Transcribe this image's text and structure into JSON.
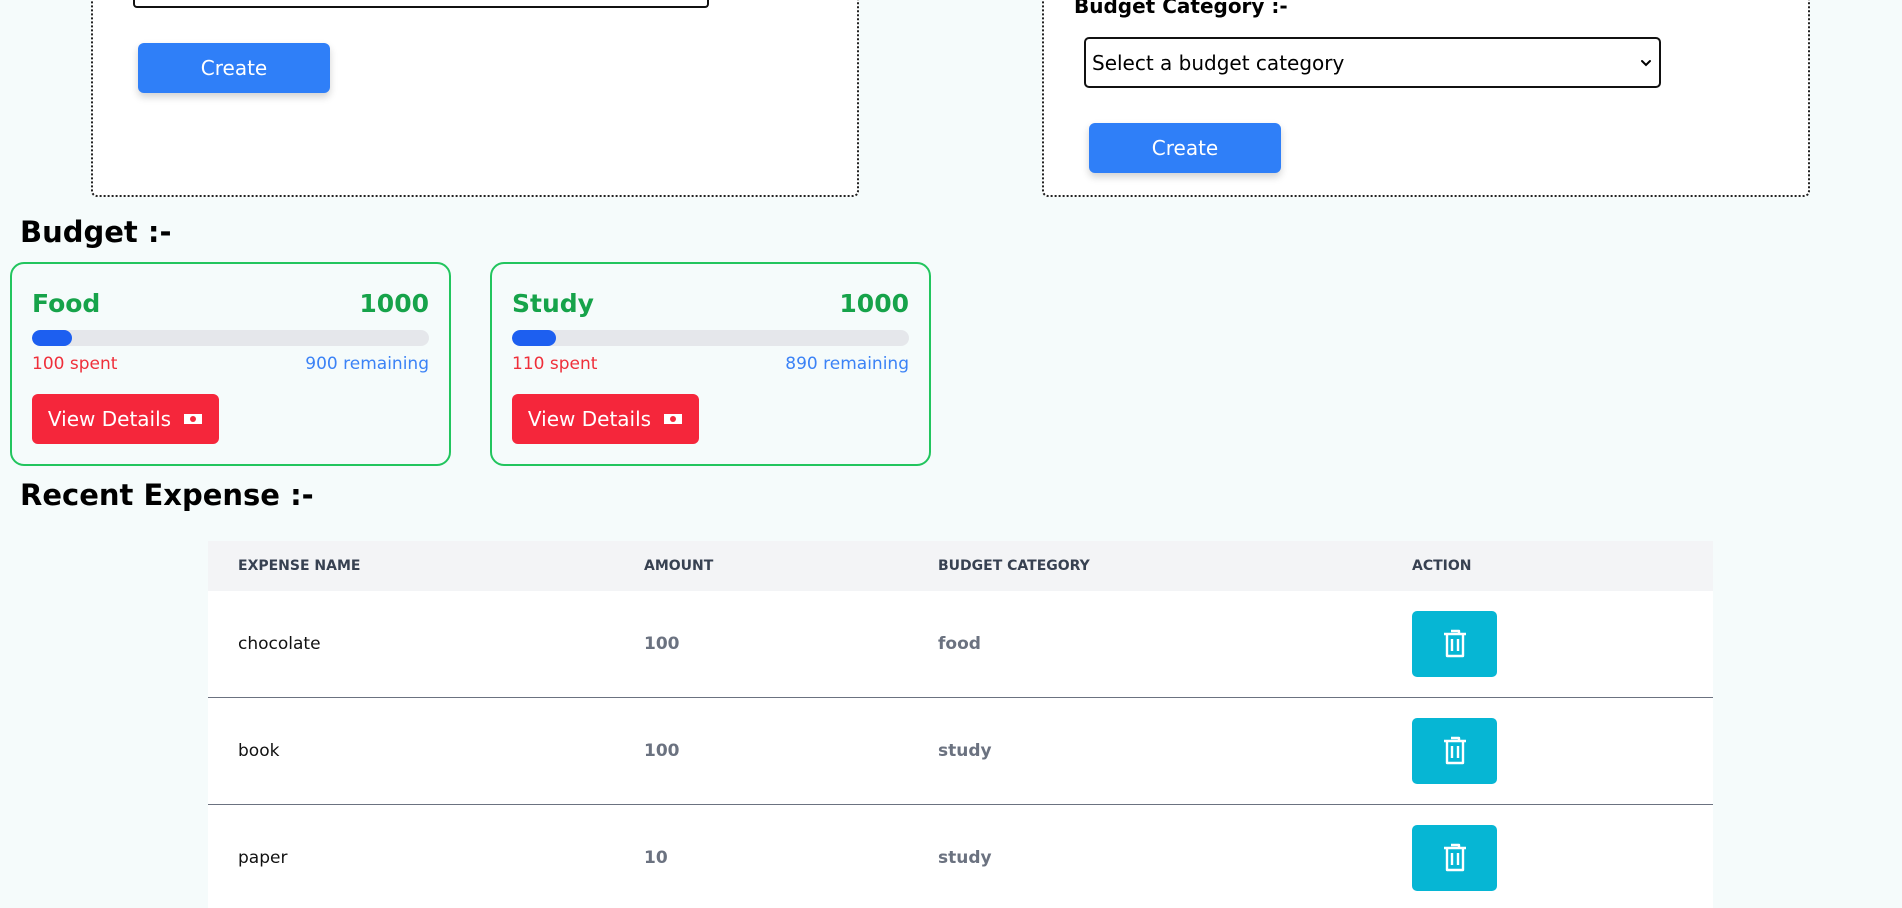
{
  "expense_form": {
    "create_label": "Create"
  },
  "budget_form": {
    "category_label": "Budget Category :-",
    "category_select": "Select a budget category",
    "create_label": "Create"
  },
  "budget_section": {
    "heading": "Budget :-",
    "cards": [
      {
        "name": "Food",
        "amount": "1000",
        "spent": "100 spent",
        "remaining": "900 remaining",
        "progress": 0.1,
        "view_label": "View Details",
        "view_icon": "money-icon"
      },
      {
        "name": "Study",
        "amount": "1000",
        "spent": "110 spent",
        "remaining": "890 remaining",
        "progress": 0.11,
        "view_label": "View Details",
        "view_icon": "money-icon"
      }
    ]
  },
  "expense_section": {
    "heading": "Recent Expense :-",
    "columns": [
      "EXPENSE NAME",
      "AMOUNT",
      "BUDGET CATEGORY",
      "ACTION"
    ],
    "rows": [
      {
        "name": "chocolate",
        "amount": "100",
        "category": "food",
        "action_icon": "trash-icon"
      },
      {
        "name": "book",
        "amount": "100",
        "category": "study",
        "action_icon": "trash-icon"
      },
      {
        "name": "paper",
        "amount": "10",
        "category": "study",
        "action_icon": "trash-icon"
      }
    ]
  },
  "colors": {
    "primary": "#2f7ff8",
    "danger": "#f5263b",
    "success": "#16a34a",
    "progress": "#1d5ff0",
    "action": "#06b6d4"
  }
}
